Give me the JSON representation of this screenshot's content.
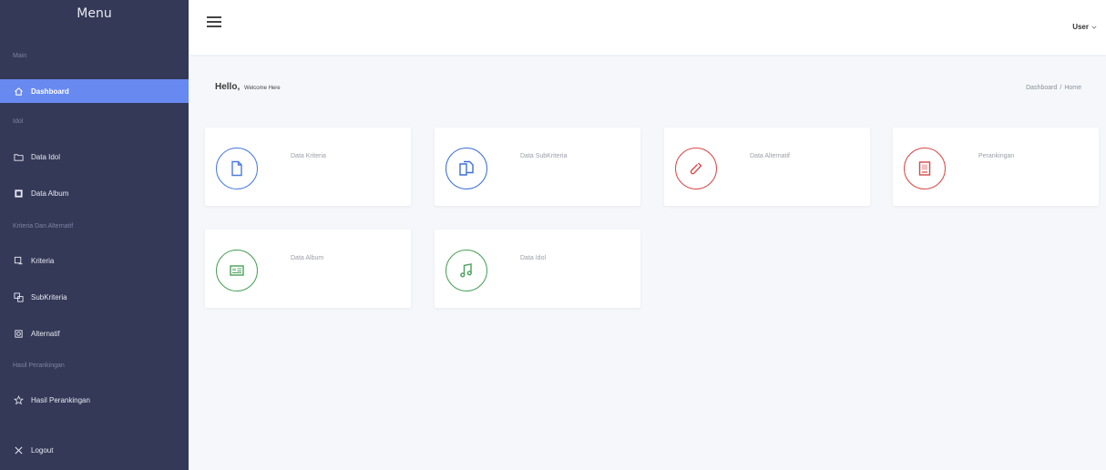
{
  "sidebar": {
    "title": "Menu",
    "sections": {
      "main": "Main",
      "idol": "Idol",
      "kriteria": "Kriteria Dan Alternatif",
      "hasil": "Hasil Perankingan"
    },
    "items": [
      {
        "label": "Dashboard",
        "icon": "home-icon"
      },
      {
        "label": "Data Idol",
        "icon": "folder-icon"
      },
      {
        "label": "Data Album",
        "icon": "album-icon"
      },
      {
        "label": "Kriteria",
        "icon": "kriteria-icon"
      },
      {
        "label": "SubKriteria",
        "icon": "subkriteria-icon"
      },
      {
        "label": "Alternatif",
        "icon": "alternatif-icon"
      },
      {
        "label": "Hasil Perankingan",
        "icon": "star-icon"
      },
      {
        "label": "Logout",
        "icon": "close-icon"
      }
    ],
    "colors": {
      "background": "#343957",
      "active": "#6889f0"
    }
  },
  "header": {
    "user_label": "User"
  },
  "page": {
    "greeting": "Hello,",
    "welcome": "Welcome Here",
    "breadcrumb": [
      "Dashboard",
      "Home"
    ]
  },
  "cards": [
    {
      "label": "Data Kriteria",
      "icon": "document-icon",
      "color": "#4a7be0"
    },
    {
      "label": "Data SubKriteria",
      "icon": "copy-icon",
      "color": "#3d6fd6"
    },
    {
      "label": "Data Alternatif",
      "icon": "link-icon",
      "color": "#d84a4a"
    },
    {
      "label": "Perankingan",
      "icon": "report-icon",
      "color": "#d84a4a"
    },
    {
      "label": "Data Album",
      "icon": "album-icon",
      "color": "#4aa05a"
    },
    {
      "label": "Data Idol",
      "icon": "music-icon",
      "color": "#4aa05a"
    }
  ]
}
